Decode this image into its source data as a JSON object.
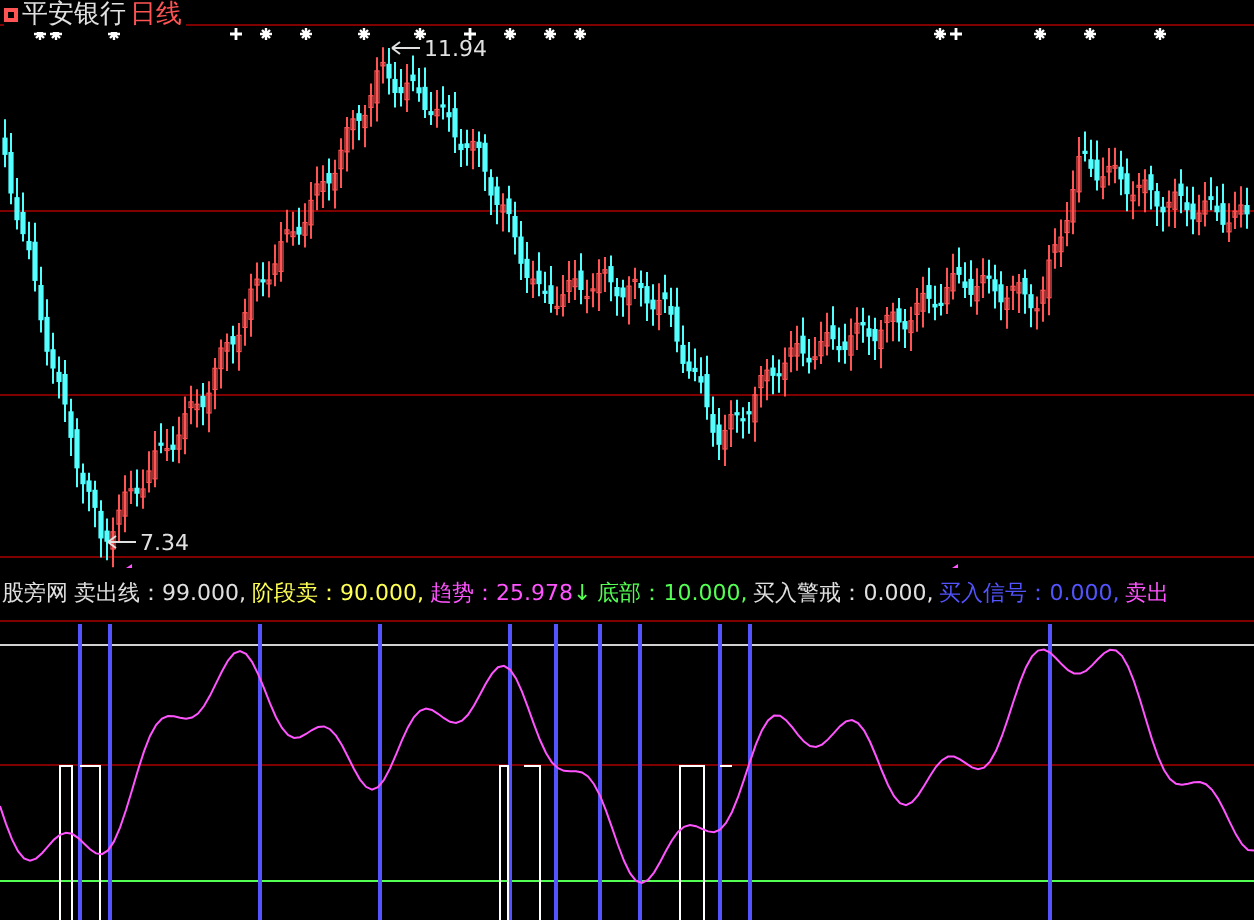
{
  "chart_header": {
    "security": "平安银行",
    "period": "日线"
  },
  "price_chart": {
    "high_label": "11.94",
    "low_label": "7.34"
  },
  "indicator_legend": [
    {
      "text": "股旁网",
      "color": "#e0e0e0"
    },
    {
      "text": "卖出线：99.000,",
      "color": "#e0e0e0"
    },
    {
      "text": "阶段卖：90.000,",
      "color": "#ffff54"
    },
    {
      "text": "趋势：25.978",
      "color": "#ff54ff",
      "arrow": "↓"
    },
    {
      "text": "底部：10.000,",
      "color": "#54ff54"
    },
    {
      "text": "买入警戒：0.000,",
      "color": "#e0e0e0"
    },
    {
      "text": "买入信号：0.000,",
      "color": "#5454ff"
    },
    {
      "text": "卖出",
      "color": "#ff54ff"
    }
  ]
}
